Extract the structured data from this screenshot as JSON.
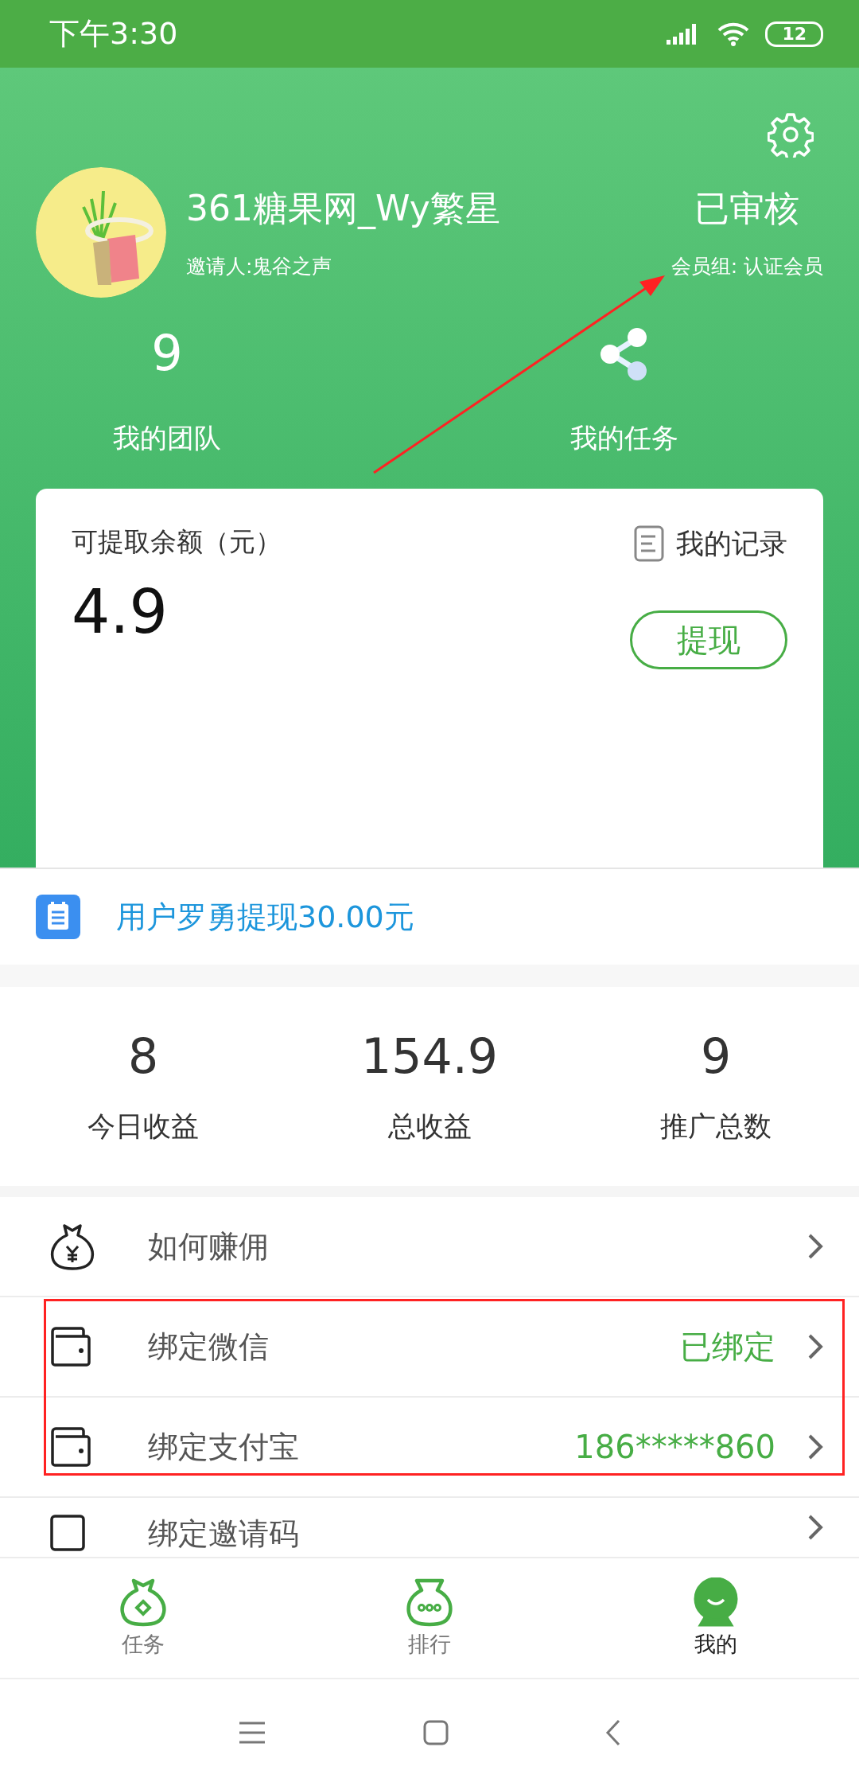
{
  "status_bar": {
    "time": "下午3:30",
    "battery": "12"
  },
  "profile": {
    "name": "361糖果网_Wy繁星",
    "inviter": "邀请人:鬼谷之声",
    "status": "已审核",
    "member_group": "会员组: 认证会员"
  },
  "shortcuts": [
    {
      "kind": "count",
      "value": "9",
      "label": "我的团队"
    },
    {
      "kind": "share",
      "label": "我的任务"
    }
  ],
  "balance_card": {
    "label": "可提取余额（元）",
    "amount": "4.9",
    "records_link": "我的记录",
    "withdraw_button": "提现"
  },
  "notice": {
    "text": "用户罗勇提现30.00元"
  },
  "stats": [
    {
      "value": "8",
      "label": "今日收益"
    },
    {
      "value": "154.9",
      "label": "总收益"
    },
    {
      "value": "9",
      "label": "推广总数"
    }
  ],
  "menu": [
    {
      "kind": "moneybag",
      "label": "如何赚佣"
    },
    {
      "kind": "wallet",
      "label": "绑定微信",
      "value": "已绑定"
    },
    {
      "kind": "wallet",
      "label": "绑定支付宝",
      "value": "186*****860"
    },
    {
      "kind": "square",
      "label": "绑定邀请码"
    }
  ],
  "tab_bar": [
    {
      "kind": "task",
      "label": "任务",
      "selected": false
    },
    {
      "kind": "rank",
      "label": "排行",
      "selected": false
    },
    {
      "kind": "me",
      "label": "我的",
      "selected": true
    }
  ]
}
